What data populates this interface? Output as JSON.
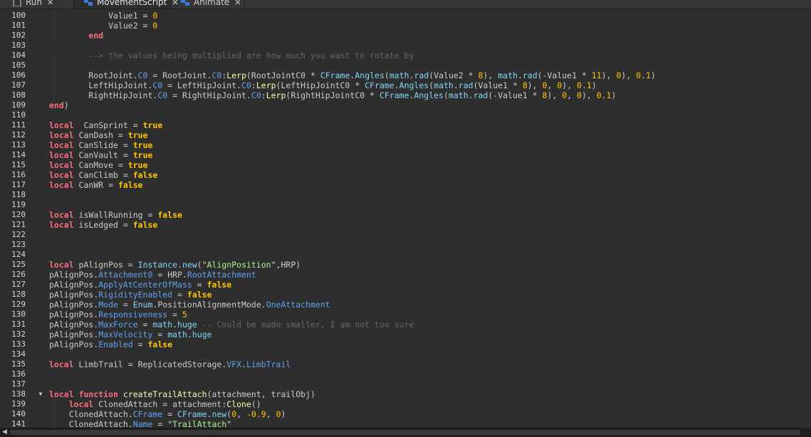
{
  "tabs": [
    {
      "label": "Run",
      "close": "✕",
      "icon": "script-icon",
      "active": false
    },
    {
      "label": "MovementScript",
      "close": "✕",
      "icon": "local-script-icon",
      "active": true
    },
    {
      "label": "Animate",
      "close": "✕",
      "icon": "local-script-icon",
      "active": false
    }
  ],
  "colors": {
    "background": "#2e2e2e",
    "keyword": "#f86d7c",
    "bool": "#ffc600",
    "builtin": "#84d6f7",
    "property": "#61a1f1",
    "method": "#fdfbac",
    "number": "#ffc600",
    "string": "#adf195",
    "comment": "#666666",
    "text": "#cccccc"
  },
  "lines": [
    {
      "n": "100",
      "seg": [
        [
          "            Value1 = ",
          "t"
        ],
        [
          "0",
          "num"
        ]
      ]
    },
    {
      "n": "101",
      "seg": [
        [
          "            Value2 = ",
          "t"
        ],
        [
          "0",
          "num"
        ]
      ]
    },
    {
      "n": "102",
      "seg": [
        [
          "        ",
          "t"
        ],
        [
          "end",
          "kw"
        ]
      ]
    },
    {
      "n": "103",
      "seg": []
    },
    {
      "n": "104",
      "seg": [
        [
          "        --> the values being multiplied are how much you want to rotate by",
          "cm"
        ]
      ]
    },
    {
      "n": "105",
      "seg": []
    },
    {
      "n": "106",
      "seg": [
        [
          "        RootJoint.",
          "t"
        ],
        [
          "C0",
          "prop"
        ],
        [
          " = RootJoint.",
          "t"
        ],
        [
          "C0",
          "prop"
        ],
        [
          ":",
          "t"
        ],
        [
          "Lerp",
          "meth"
        ],
        [
          "(RootJointC0 * ",
          "t"
        ],
        [
          "CFrame",
          "bi"
        ],
        [
          ".",
          "t"
        ],
        [
          "Angles",
          "bi"
        ],
        [
          "(",
          "t"
        ],
        [
          "math",
          "bi"
        ],
        [
          ".",
          "t"
        ],
        [
          "rad",
          "bi"
        ],
        [
          "(Value2 * ",
          "t"
        ],
        [
          "8",
          "num"
        ],
        [
          "), ",
          "t"
        ],
        [
          "math",
          "bi"
        ],
        [
          ".",
          "t"
        ],
        [
          "rad",
          "bi"
        ],
        [
          "(-Value1 * ",
          "t"
        ],
        [
          "11",
          "num"
        ],
        [
          "), ",
          "t"
        ],
        [
          "0",
          "num"
        ],
        [
          "), ",
          "t"
        ],
        [
          "0.1",
          "num"
        ],
        [
          ")",
          "t"
        ]
      ]
    },
    {
      "n": "107",
      "seg": [
        [
          "        LeftHipJoint.",
          "t"
        ],
        [
          "C0",
          "prop"
        ],
        [
          " = LeftHipJoint.",
          "t"
        ],
        [
          "C0",
          "prop"
        ],
        [
          ":",
          "t"
        ],
        [
          "Lerp",
          "meth"
        ],
        [
          "(LeftHipJointC0 * ",
          "t"
        ],
        [
          "CFrame",
          "bi"
        ],
        [
          ".",
          "t"
        ],
        [
          "Angles",
          "bi"
        ],
        [
          "(",
          "t"
        ],
        [
          "math",
          "bi"
        ],
        [
          ".",
          "t"
        ],
        [
          "rad",
          "bi"
        ],
        [
          "(Value1 * ",
          "t"
        ],
        [
          "8",
          "num"
        ],
        [
          "), ",
          "t"
        ],
        [
          "0",
          "num"
        ],
        [
          ", ",
          "t"
        ],
        [
          "0",
          "num"
        ],
        [
          "), ",
          "t"
        ],
        [
          "0.1",
          "num"
        ],
        [
          ")",
          "t"
        ]
      ]
    },
    {
      "n": "108",
      "seg": [
        [
          "        RightHipJoint.",
          "t"
        ],
        [
          "C0",
          "prop"
        ],
        [
          " = RightHipJoint.",
          "t"
        ],
        [
          "C0",
          "prop"
        ],
        [
          ":",
          "t"
        ],
        [
          "Lerp",
          "meth"
        ],
        [
          "(RightHipJointC0 * ",
          "t"
        ],
        [
          "CFrame",
          "bi"
        ],
        [
          ".",
          "t"
        ],
        [
          "Angles",
          "bi"
        ],
        [
          "(",
          "t"
        ],
        [
          "math",
          "bi"
        ],
        [
          ".",
          "t"
        ],
        [
          "rad",
          "bi"
        ],
        [
          "(-Value1 * ",
          "t"
        ],
        [
          "8",
          "num"
        ],
        [
          "), ",
          "t"
        ],
        [
          "0",
          "num"
        ],
        [
          ", ",
          "t"
        ],
        [
          "0",
          "num"
        ],
        [
          "), ",
          "t"
        ],
        [
          "0.1",
          "num"
        ],
        [
          ")",
          "t"
        ]
      ]
    },
    {
      "n": "109",
      "seg": [
        [
          "end",
          "kw"
        ],
        [
          ")",
          "t"
        ]
      ]
    },
    {
      "n": "110",
      "seg": []
    },
    {
      "n": "111",
      "seg": [
        [
          "local",
          "kw"
        ],
        [
          "  CanSprint = ",
          "t"
        ],
        [
          "true",
          "bool"
        ]
      ]
    },
    {
      "n": "112",
      "seg": [
        [
          "local",
          "kw"
        ],
        [
          " CanDash = ",
          "t"
        ],
        [
          "true",
          "bool"
        ]
      ]
    },
    {
      "n": "113",
      "seg": [
        [
          "local",
          "kw"
        ],
        [
          " CanSlide = ",
          "t"
        ],
        [
          "true",
          "bool"
        ]
      ]
    },
    {
      "n": "114",
      "seg": [
        [
          "local",
          "kw"
        ],
        [
          " CanVault = ",
          "t"
        ],
        [
          "true",
          "bool"
        ]
      ]
    },
    {
      "n": "115",
      "seg": [
        [
          "local",
          "kw"
        ],
        [
          " CanMove = ",
          "t"
        ],
        [
          "true",
          "bool"
        ]
      ]
    },
    {
      "n": "116",
      "seg": [
        [
          "local",
          "kw"
        ],
        [
          " CanClimb = ",
          "t"
        ],
        [
          "false",
          "bool"
        ]
      ]
    },
    {
      "n": "117",
      "seg": [
        [
          "local",
          "kw"
        ],
        [
          " CanWR = ",
          "t"
        ],
        [
          "false",
          "bool"
        ]
      ]
    },
    {
      "n": "118",
      "seg": []
    },
    {
      "n": "119",
      "seg": []
    },
    {
      "n": "120",
      "seg": [
        [
          "local",
          "kw"
        ],
        [
          " isWallRunning = ",
          "t"
        ],
        [
          "false",
          "bool"
        ]
      ]
    },
    {
      "n": "121",
      "seg": [
        [
          "local",
          "kw"
        ],
        [
          " isLedged = ",
          "t"
        ],
        [
          "false",
          "bool"
        ]
      ]
    },
    {
      "n": "122",
      "seg": []
    },
    {
      "n": "123",
      "seg": []
    },
    {
      "n": "124",
      "seg": []
    },
    {
      "n": "125",
      "seg": [
        [
          "local",
          "kw"
        ],
        [
          " pAlignPos = ",
          "t"
        ],
        [
          "Instance",
          "bi"
        ],
        [
          ".",
          "t"
        ],
        [
          "new",
          "bi"
        ],
        [
          "(",
          "t"
        ],
        [
          "\"AlignPosition\"",
          "str"
        ],
        [
          ",HRP)",
          "t"
        ]
      ]
    },
    {
      "n": "126",
      "seg": [
        [
          "pAlignPos.",
          "t"
        ],
        [
          "Attachment0",
          "prop"
        ],
        [
          " = HRP.",
          "t"
        ],
        [
          "RootAttachment",
          "prop"
        ]
      ]
    },
    {
      "n": "127",
      "seg": [
        [
          "pAlignPos.",
          "t"
        ],
        [
          "ApplyAtCenterOfMass",
          "prop"
        ],
        [
          " = ",
          "t"
        ],
        [
          "false",
          "bool"
        ]
      ]
    },
    {
      "n": "128",
      "seg": [
        [
          "pAlignPos.",
          "t"
        ],
        [
          "RigidityEnabled",
          "prop"
        ],
        [
          " = ",
          "t"
        ],
        [
          "false",
          "bool"
        ]
      ]
    },
    {
      "n": "129",
      "seg": [
        [
          "pAlignPos.",
          "t"
        ],
        [
          "Mode",
          "prop"
        ],
        [
          " = ",
          "t"
        ],
        [
          "Enum",
          "bi"
        ],
        [
          ".PositionAlignmentMode.",
          "t"
        ],
        [
          "OneAttachment",
          "prop"
        ]
      ]
    },
    {
      "n": "130",
      "seg": [
        [
          "pAlignPos.",
          "t"
        ],
        [
          "Responsiveness",
          "prop"
        ],
        [
          " = ",
          "t"
        ],
        [
          "5",
          "num"
        ]
      ]
    },
    {
      "n": "131",
      "seg": [
        [
          "pAlignPos.",
          "t"
        ],
        [
          "MaxForce",
          "prop"
        ],
        [
          " = ",
          "t"
        ],
        [
          "math",
          "bi"
        ],
        [
          ".",
          "t"
        ],
        [
          "huge",
          "bi"
        ],
        [
          " -- Could be made smaller, I am not too sure",
          "cm"
        ]
      ]
    },
    {
      "n": "132",
      "seg": [
        [
          "pAlignPos.",
          "t"
        ],
        [
          "MaxVelocity",
          "prop"
        ],
        [
          " = ",
          "t"
        ],
        [
          "math",
          "bi"
        ],
        [
          ".",
          "t"
        ],
        [
          "huge",
          "bi"
        ]
      ]
    },
    {
      "n": "133",
      "seg": [
        [
          "pAlignPos.",
          "t"
        ],
        [
          "Enabled",
          "prop"
        ],
        [
          " = ",
          "t"
        ],
        [
          "false",
          "bool"
        ]
      ]
    },
    {
      "n": "134",
      "seg": []
    },
    {
      "n": "135",
      "seg": [
        [
          "local",
          "kw"
        ],
        [
          " LimbTrail = ReplicatedStorage.",
          "t"
        ],
        [
          "VFX",
          "prop"
        ],
        [
          ".",
          "t"
        ],
        [
          "LimbTrail",
          "prop"
        ]
      ]
    },
    {
      "n": "136",
      "seg": []
    },
    {
      "n": "137",
      "seg": []
    },
    {
      "n": "138",
      "fold": "▼",
      "seg": [
        [
          "local",
          "kw"
        ],
        [
          " ",
          "t"
        ],
        [
          "function",
          "kw"
        ],
        [
          " ",
          "t"
        ],
        [
          "createTrailAttach",
          "meth"
        ],
        [
          "(attachment, trailObj)",
          "t"
        ]
      ]
    },
    {
      "n": "139",
      "seg": [
        [
          "    ",
          "t"
        ],
        [
          "local",
          "kw"
        ],
        [
          " ClonedAttach = attachment:",
          "t"
        ],
        [
          "Clone",
          "meth"
        ],
        [
          "()",
          "t"
        ]
      ]
    },
    {
      "n": "140",
      "seg": [
        [
          "    ClonedAttach.",
          "t"
        ],
        [
          "CFrame",
          "prop"
        ],
        [
          " = ",
          "t"
        ],
        [
          "CFrame",
          "bi"
        ],
        [
          ".",
          "t"
        ],
        [
          "new",
          "bi"
        ],
        [
          "(",
          "t"
        ],
        [
          "0",
          "num"
        ],
        [
          ", ",
          "t"
        ],
        [
          "-0.9",
          "num"
        ],
        [
          ", ",
          "t"
        ],
        [
          "0",
          "num"
        ],
        [
          ")",
          "t"
        ]
      ]
    },
    {
      "n": "141",
      "seg": [
        [
          "    ClonedAttach.",
          "t"
        ],
        [
          "Name",
          "prop"
        ],
        [
          " = ",
          "t"
        ],
        [
          "\"TrailAttach\"",
          "str"
        ]
      ]
    }
  ],
  "scrollbar": {
    "left_arrow": "◀"
  }
}
